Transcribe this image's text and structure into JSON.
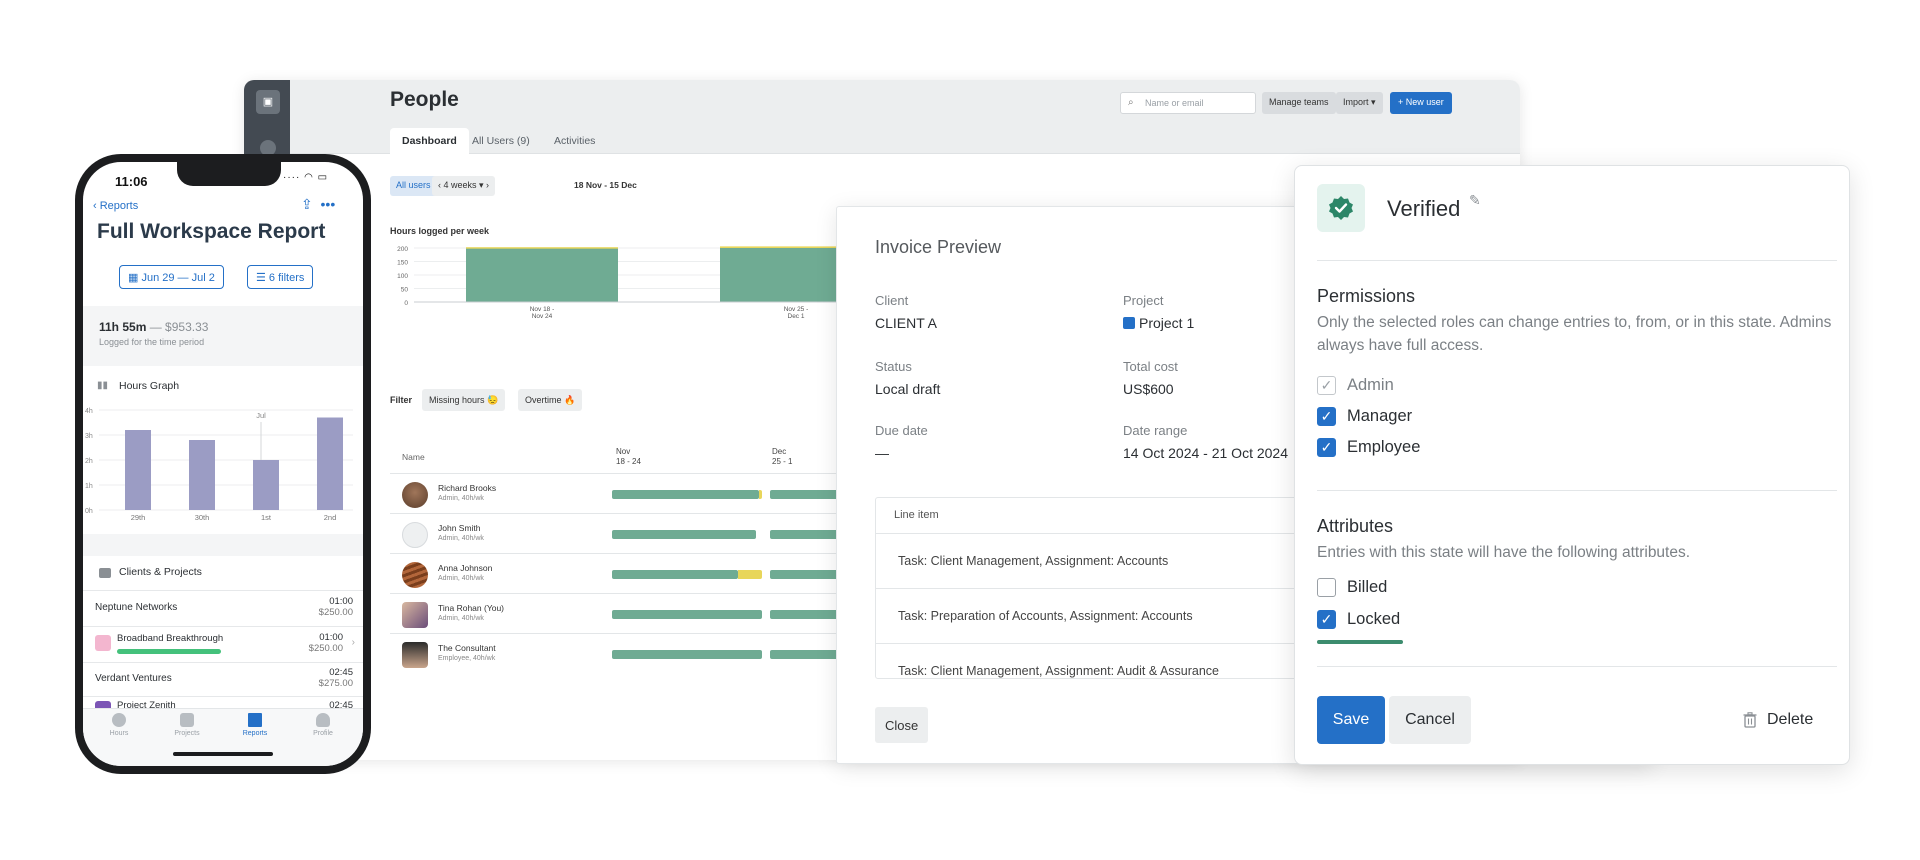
{
  "desktop": {
    "title": "People",
    "search_placeholder": "Name or email",
    "manage_teams": "Manage teams",
    "import": "Import ▾",
    "new_user": "+ New user",
    "tabs": [
      "Dashboard",
      "All Users (9)",
      "Activities"
    ],
    "all_users": "All users ▾",
    "weeks": "‹  4 weeks ▾  ›",
    "date_range": "18 Nov - 15 Dec",
    "hours_title": "Hours logged per week",
    "filter_label": "Filter",
    "chips": [
      "Missing hours 😓",
      "Overtime 🔥"
    ],
    "table_header_name": "Name",
    "period_headers": [
      {
        "month": "Nov",
        "range": "18 - 24"
      },
      {
        "month": "Dec",
        "range": "25 - 1"
      }
    ],
    "users": [
      {
        "name": "Richard Brooks",
        "sub": "Admin, 40h/wk",
        "fill": 0.98,
        "overtime": 0.02
      },
      {
        "name": "John Smith",
        "sub": "Admin, 40h/wk",
        "fill": 0.96,
        "overtime": 0
      },
      {
        "name": "Anna Johnson",
        "sub": "Admin, 40h/wk",
        "fill": 0.84,
        "overtime": 0.16
      },
      {
        "name": "Tina Rohan (You)",
        "sub": "Admin, 40h/wk",
        "fill": 1.0,
        "overtime": 0
      },
      {
        "name": "The Consultant",
        "sub": "Employee, 40h/wk",
        "fill": 1.0,
        "overtime": 0
      }
    ]
  },
  "chart_data": {
    "type": "bar",
    "categories": [
      "Nov 18 - Nov 24",
      "Nov 25 - Dec 1"
    ],
    "series": [
      {
        "values": [
          200,
          200
        ]
      },
      {
        "values": [
          3,
          6
        ]
      }
    ],
    "yticks": [
      "200",
      "150",
      "100",
      "50",
      "0"
    ],
    "ylim": [
      0,
      200
    ],
    "x_tick_labels": [
      [
        "Nov 18 -",
        "Nov 24"
      ],
      [
        "Nov 25 -",
        "Dec 1"
      ]
    ],
    "colors": [
      "#6fab93",
      "#e8d65a"
    ]
  },
  "invoice": {
    "title": "Invoice Preview",
    "client_label": "Client",
    "client": "CLIENT A",
    "project_label": "Project",
    "project": "Project 1",
    "status_label": "Status",
    "status": "Local draft",
    "total_label": "Total cost",
    "total": "US$600",
    "due_label": "Due date",
    "due": "—",
    "range_label": "Date range",
    "range": "14 Oct 2024 - 21 Oct 2024",
    "line_header": "Line item",
    "lines": [
      "Task: Client Management, Assignment: Accounts",
      "Task: Preparation of Accounts, Assignment: Accounts",
      "Task: Client Management, Assignment: Audit & Assurance"
    ],
    "close": "Close"
  },
  "state": {
    "title": "Verified",
    "perm_title": "Permissions",
    "perm_desc": "Only the selected roles can change entries to, from, or in this state. Admins always have full access.",
    "roles": [
      {
        "label": "Admin",
        "checked": true,
        "disabled": true
      },
      {
        "label": "Manager",
        "checked": true,
        "disabled": false
      },
      {
        "label": "Employee",
        "checked": true,
        "disabled": false
      }
    ],
    "attr_title": "Attributes",
    "attr_desc": "Entries with this state will have the following attributes.",
    "attrs": [
      {
        "label": "Billed",
        "checked": false
      },
      {
        "label": "Locked",
        "checked": true
      }
    ],
    "save": "Save",
    "cancel": "Cancel",
    "delete": "Delete",
    "accent": "#2470c7"
  },
  "phone": {
    "time": "11:06",
    "back": "‹ Reports",
    "title": "Full Workspace Report",
    "date_pill": "Jun 29 — Jul 2",
    "filters_pill": "6 filters",
    "hours": "11h 55m",
    "money": " — $953.33",
    "sub": "Logged for the time period",
    "graph_title": "Hours Graph",
    "clients_title": "Clients & Projects",
    "rows": [
      {
        "client": "Neptune Networks",
        "time": "01:00",
        "amount": "$250.00"
      },
      {
        "project": "Broadband Breakthrough",
        "time": "01:00",
        "amount": "$250.00"
      },
      {
        "client": "Verdant Ventures",
        "time": "02:45",
        "amount": "$275.00"
      },
      {
        "project": "Project Zenith",
        "time": "02:45"
      }
    ],
    "tabs": [
      "Hours",
      "Projects",
      "Reports",
      "Profile"
    ]
  },
  "phone_chart": {
    "type": "bar",
    "categories": [
      "29th",
      "30th",
      "1st",
      "2nd"
    ],
    "values": [
      3.2,
      2.8,
      2.0,
      3.7
    ],
    "yticks": [
      "4h",
      "3h",
      "2h",
      "1h",
      "0h"
    ],
    "ylim": [
      0,
      4
    ],
    "marker": "Jul",
    "color": "#9b9cc4"
  }
}
